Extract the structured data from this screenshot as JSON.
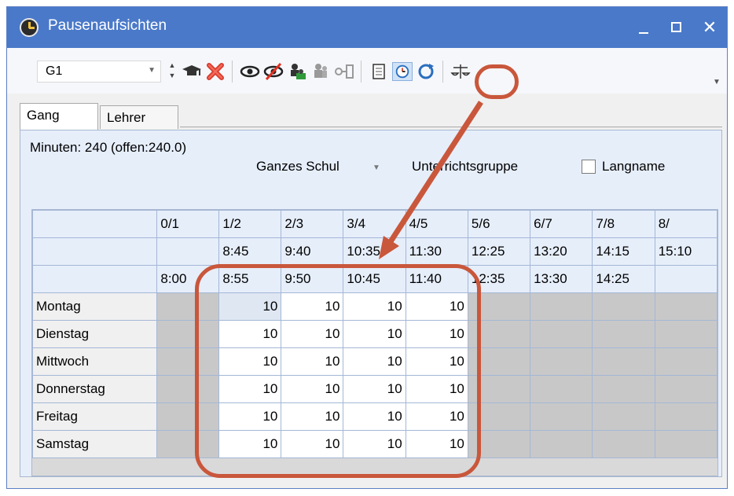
{
  "window": {
    "title": "Pausenaufsichten",
    "controls": {
      "close": "✕"
    }
  },
  "toolbar": {
    "combo_value": "G1",
    "icons": [
      "mortarboard-icon",
      "delete-x-icon",
      "eye-icon",
      "eye-crossed-icon",
      "teacher-assign-icon",
      "teacher-remove-icon",
      "key-list-icon",
      "calendar-icon",
      "clock-icon",
      "refresh-icon",
      "balance-scale-icon"
    ]
  },
  "tabs": [
    {
      "label": "Gang",
      "active": true
    },
    {
      "label": "Lehrer",
      "active": false
    }
  ],
  "info": {
    "minutes": "Minuten: 240 (offen:240.0)",
    "scope": "Ganzes Schul",
    "group_label": "Unterrichtsgruppe",
    "langname_label": "Langname",
    "langname_checked": false
  },
  "grid": {
    "periods": [
      "0/1",
      "1/2",
      "2/3",
      "3/4",
      "4/5",
      "5/6",
      "6/7",
      "7/8",
      "8/"
    ],
    "start_times": [
      "",
      "8:45",
      "9:40",
      "10:35",
      "11:30",
      "12:25",
      "13:20",
      "14:15",
      "15:10"
    ],
    "end_times": [
      "8:00",
      "8:55",
      "9:50",
      "10:45",
      "11:40",
      "12:35",
      "13:30",
      "14:25",
      ""
    ],
    "days": [
      {
        "name": "Montag",
        "values": [
          "10",
          "10",
          "10",
          "10"
        ]
      },
      {
        "name": "Dienstag",
        "values": [
          "10",
          "10",
          "10",
          "10"
        ]
      },
      {
        "name": "Mittwoch",
        "values": [
          "10",
          "10",
          "10",
          "10"
        ]
      },
      {
        "name": "Donnerstag",
        "values": [
          "10",
          "10",
          "10",
          "10"
        ]
      },
      {
        "name": "Freitag",
        "values": [
          "10",
          "10",
          "10",
          "10"
        ]
      },
      {
        "name": "Samstag",
        "values": [
          "10",
          "10",
          "10",
          "10"
        ]
      }
    ]
  },
  "colors": {
    "titlebar": "#4a79c9",
    "annotation": "#c9573b",
    "grid_header": "#e6eefa",
    "cell_inactive": "#c8c8c8"
  }
}
